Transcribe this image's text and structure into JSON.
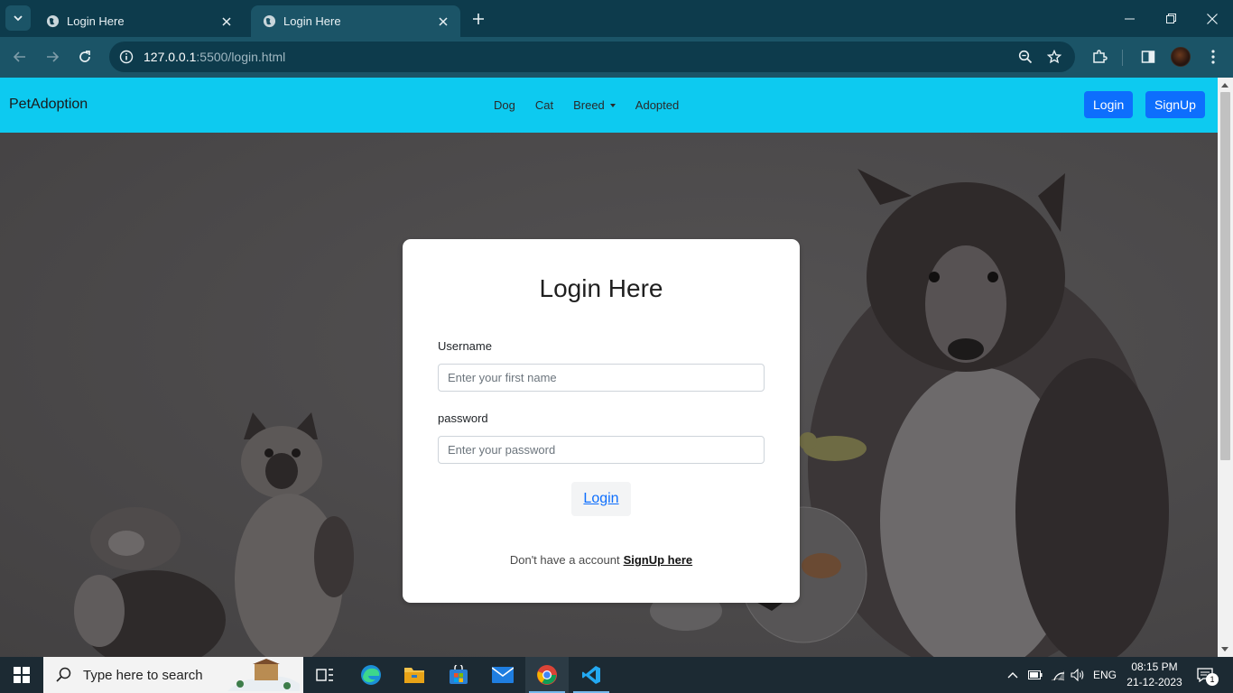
{
  "browser": {
    "tabs": [
      {
        "title": "Login Here",
        "active": false
      },
      {
        "title": "Login Here",
        "active": true
      }
    ],
    "url_host": "127.0.0.1",
    "url_rest": ":5500/login.html"
  },
  "navbar": {
    "brand": "PetAdoption",
    "links": [
      "Dog",
      "Cat",
      "Breed",
      "Adopted"
    ],
    "login_label": "Login",
    "signup_label": "SignUp",
    "accent": "#0dcaf0",
    "button_color": "#0d6efd"
  },
  "login_card": {
    "title": "Login Here",
    "username_label": "Username",
    "username_placeholder": "Enter your first name",
    "password_label": "password",
    "password_placeholder": "Enter your password",
    "submit_label": "Login",
    "signup_prompt": "Don't have a account",
    "signup_link": "SignUp here"
  },
  "taskbar": {
    "search_placeholder": "Type here to search",
    "language": "ENG",
    "time": "08:15 PM",
    "date": "21-12-2023",
    "notification_count": "1",
    "pinned_apps": [
      "task-view-icon",
      "edge-icon",
      "file-explorer-icon",
      "store-icon",
      "mail-icon",
      "chrome-icon",
      "vscode-icon"
    ]
  }
}
